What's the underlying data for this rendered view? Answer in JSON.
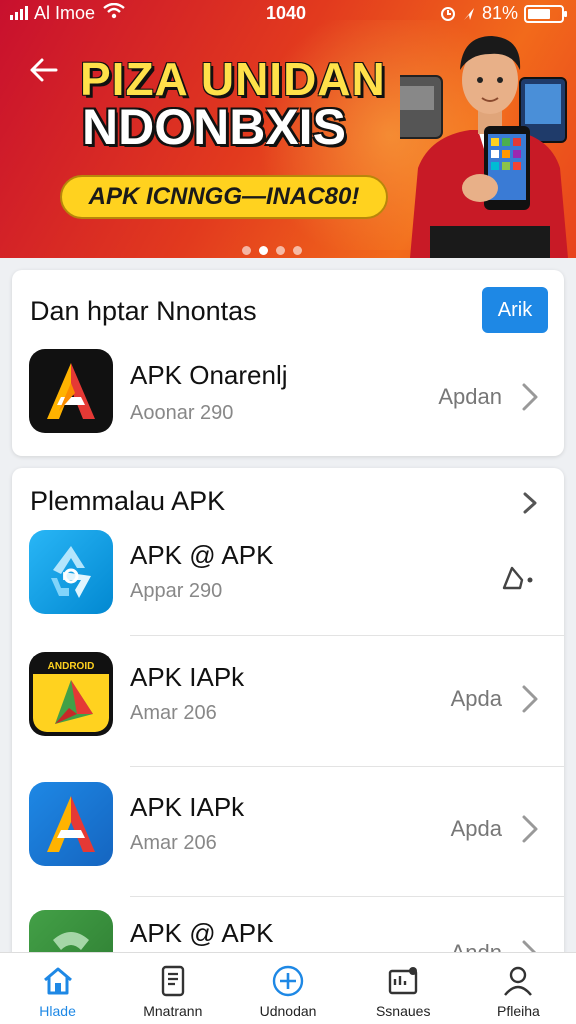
{
  "status_bar": {
    "carrier": "Al Imoe",
    "time": "1040",
    "battery": "81%"
  },
  "banner": {
    "headline_top": "PIZA UNIDAN",
    "headline_bottom": "NDONBXIS",
    "promo": "APK ICNNGG—INAC80!",
    "carousel_pages": 4,
    "carousel_active": 1,
    "colors": {
      "background": "#e23a1e",
      "headline_accent": "#ffe14a",
      "pill": "#ffd21f"
    }
  },
  "featured": {
    "title": "Dan hptar Nnontas",
    "button_label": "Arik",
    "app": {
      "name": "APK Onarenlj",
      "size": "Aoonar 290",
      "action": "Apdan"
    }
  },
  "popular": {
    "title": "Plemmalau APK",
    "apps": [
      {
        "name": "APK @ APK",
        "size": "Appar 290",
        "action": "",
        "icon": "recycle-icon"
      },
      {
        "name": "APK IAPk",
        "size": "Amar 206",
        "action": "Apda",
        "icon": "play-icon"
      },
      {
        "name": "APK IAPk",
        "size": "Amar 206",
        "action": "Apda",
        "icon": "a-logo-icon"
      },
      {
        "name": "APK @ APK",
        "size": "",
        "action": "Andn",
        "icon": "green-app-icon"
      }
    ]
  },
  "bottom_nav": {
    "items": [
      {
        "label": "Hlade",
        "icon": "home-icon",
        "active": true
      },
      {
        "label": "Mnatrann",
        "icon": "document-icon",
        "active": false
      },
      {
        "label": "Udnodan",
        "icon": "plus-circle-icon",
        "active": false
      },
      {
        "label": "Ssnaues",
        "icon": "apps-icon",
        "active": false
      },
      {
        "label": "Pfleiha",
        "icon": "profile-icon",
        "active": false
      }
    ],
    "accent": "#1e88e5"
  }
}
